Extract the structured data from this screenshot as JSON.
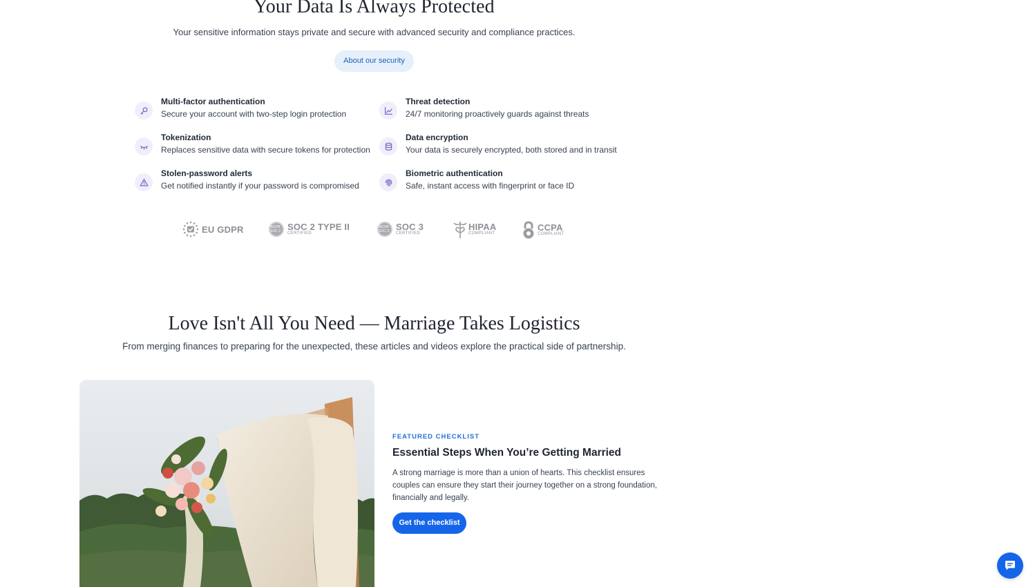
{
  "security": {
    "title": "Your Data Is Always Protected",
    "subtitle": "Your sensitive information stays private and secure with advanced security and compliance practices.",
    "button_label": "About our security",
    "features": [
      {
        "title": "Multi-factor authentication",
        "desc": "Secure your account with two-step login protection",
        "icon": "key-icon"
      },
      {
        "title": "Threat detection",
        "desc": "24/7 monitoring proactively guards against threats",
        "icon": "chart-line-icon"
      },
      {
        "title": "Tokenization",
        "desc": "Replaces sensitive data with secure tokens for protection",
        "icon": "eye-closed-icon"
      },
      {
        "title": "Data encryption",
        "desc": "Your data is securely encrypted, both stored and in transit",
        "icon": "database-icon"
      },
      {
        "title": "Stolen-password alerts",
        "desc": "Get notified instantly if your password is compromised",
        "icon": "warning-icon"
      },
      {
        "title": "Biometric authentication",
        "desc": "Safe, instant access with fingerprint or face ID",
        "icon": "fingerprint-icon"
      }
    ],
    "badges": [
      {
        "name": "EU GDPR",
        "sub": ""
      },
      {
        "name": "SOC 2 TYPE II",
        "sub": "CERTIFIED",
        "seal": "AICPA SOC 2"
      },
      {
        "name": "SOC 3",
        "sub": "CERTIFIED",
        "seal": "AICPA SOC 3"
      },
      {
        "name": "HIPAA",
        "sub": "COMPLIANT"
      },
      {
        "name": "CCPA",
        "sub": "COMPLIANT"
      }
    ]
  },
  "love": {
    "title": "Love Isn't All You Need — Marriage Takes Logistics",
    "subtitle": "From merging finances to preparing for the unexpected, these articles and videos explore the practical side of partnership."
  },
  "featured": {
    "eyebrow": "FEATURED CHECKLIST",
    "title": "Essential Steps When You’re Getting Married",
    "body": "A strong marriage is more than a union of hearts. This checklist ensures couples can ensure they start their journey together on a strong foundation, financially and legally.",
    "button_label": "Get the checklist"
  },
  "colors": {
    "accent": "#1565e9",
    "pill_bg": "#e5f0fb",
    "icon_tint": "#7d6bc7",
    "badge_gray": "#8c8f95"
  }
}
